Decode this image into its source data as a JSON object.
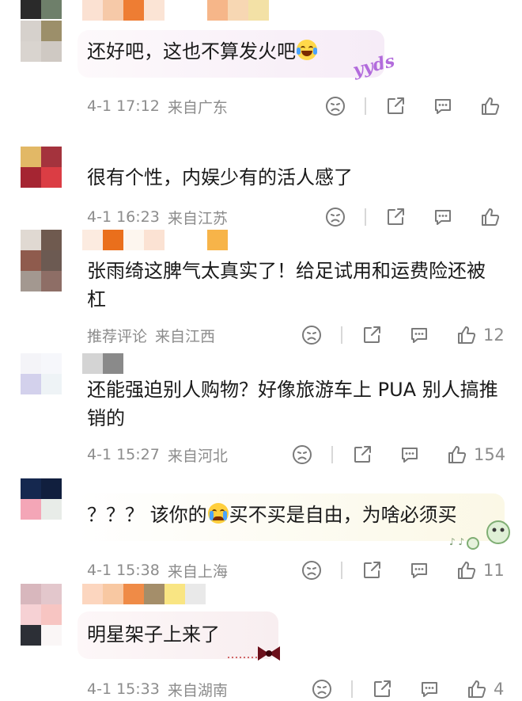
{
  "comments": [
    {
      "text": "还好吧，这也不算发火吧",
      "emoji": "laughing-tears",
      "sticker": "yyds",
      "date": "4-1 17:12",
      "location": "来自广东",
      "likes": ""
    },
    {
      "text": "很有个性，内娱少有的活人感了",
      "date": "4-1 16:23",
      "location": "来自江苏",
      "likes": ""
    },
    {
      "text": "张雨绮这脾气太真实了！给足试用和运费险还被杠",
      "date": "推荐评论",
      "location": "来自江西",
      "likes": "12"
    },
    {
      "text": "还能强迫别人购物？好像旅游车上 PUA 别人搞推销的",
      "date": "4-1 15:27",
      "location": "来自河北",
      "likes": "154"
    },
    {
      "text_before": "？？？ 该你的",
      "emoji": "crying",
      "text_after": "买不买是自由，为啥必须买",
      "date": "4-1 15:38",
      "location": "来自上海",
      "likes": "11"
    },
    {
      "text": "明星架子上来了",
      "date": "4-1 15:33",
      "location": "来自湖南",
      "likes": "4"
    }
  ],
  "icons": {
    "dislike": "sad-face-icon",
    "share": "share-icon",
    "reply": "comment-icon",
    "like": "thumbs-up-icon"
  },
  "colors": {
    "text": "#1a1a1a",
    "meta": "#8c8c8c",
    "icon": "#7a7a7a"
  }
}
